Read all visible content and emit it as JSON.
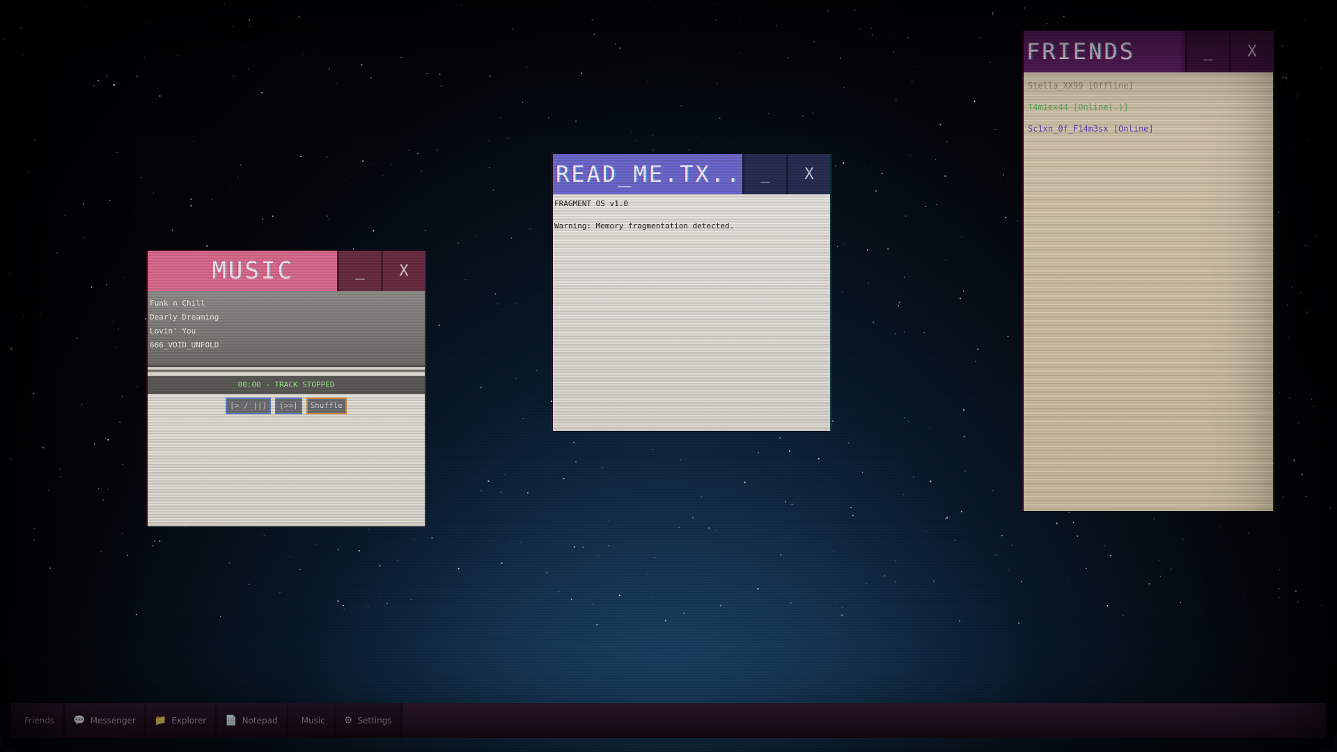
{
  "windows": {
    "music": {
      "title": "MUSIC",
      "minimize_label": "_",
      "close_label": "X",
      "tracks": [
        "Funk n Chill",
        "Dearly Dreaming",
        "Lovin' You",
        "666_VOID_UNFOLD"
      ],
      "status": "00:00 - TRACK STOPPED",
      "controls": {
        "play_pause": "[> / ||]",
        "next": "[>>]",
        "shuffle": "Shuffle"
      }
    },
    "readme": {
      "title": "READ_ME.TX...",
      "minimize_label": "_",
      "close_label": "X",
      "lines": [
        "FRAGMENT OS v1.0",
        "",
        "Warning: Memory fragmentation detected."
      ]
    },
    "friends": {
      "title": "FRIENDS",
      "minimize_label": "_",
      "close_label": "X",
      "entries": [
        {
          "name": "Stella_XX99 [Offline]",
          "color": "#8a8170"
        },
        {
          "name": "T4m1ex44 [Online(.)]",
          "color": "#5fae5f"
        },
        {
          "name": "Sc1xn_0f_F14m3sx [Online]",
          "color": "#5b3fb0"
        }
      ]
    }
  },
  "taskbar": {
    "items": [
      {
        "label": "Friends",
        "icon": "friends-icon",
        "glyph": ""
      },
      {
        "label": "Messenger",
        "icon": "speech-bubble-icon",
        "glyph": "💬"
      },
      {
        "label": "Explorer",
        "icon": "folder-icon",
        "glyph": "📁"
      },
      {
        "label": "Notepad",
        "icon": "notepad-icon",
        "glyph": "📄"
      },
      {
        "label": "Music",
        "icon": "music-icon",
        "glyph": ""
      },
      {
        "label": "Settings",
        "icon": "gear-icon",
        "glyph": "⚙"
      }
    ]
  },
  "colors": {
    "music_titlebar": "#d96b8d",
    "readme_titlebar": "#6c68cc",
    "friends_titlebar": "#5a1e5e",
    "taskbar": "#3a1d3a",
    "status_text": "#9de08a"
  }
}
